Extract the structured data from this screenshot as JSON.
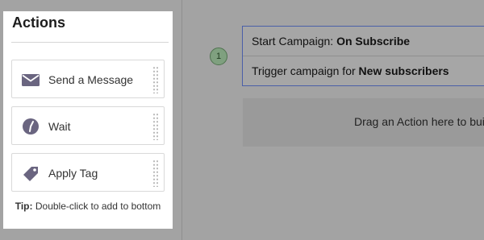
{
  "sidebar": {
    "title": "Actions",
    "actions": [
      {
        "label": "Send a Message",
        "icon": "envelope-icon"
      },
      {
        "label": "Wait",
        "icon": "clock-icon"
      },
      {
        "label": "Apply Tag",
        "icon": "tag-icon"
      }
    ],
    "tip_label": "Tip:",
    "tip_text": " Double-click to add to bottom"
  },
  "canvas": {
    "step_number": "1",
    "trigger": {
      "title_prefix": "Start Campaign: ",
      "title_value": "On Subscribe",
      "description_prefix": "Trigger campaign for ",
      "description_value": "New subscribers"
    },
    "drop_zone_text": "Drag an Action here to build"
  },
  "colors": {
    "icon": "#6a6580",
    "step_badge": "#7fa07f",
    "trigger_border": "#4a5fa8"
  }
}
